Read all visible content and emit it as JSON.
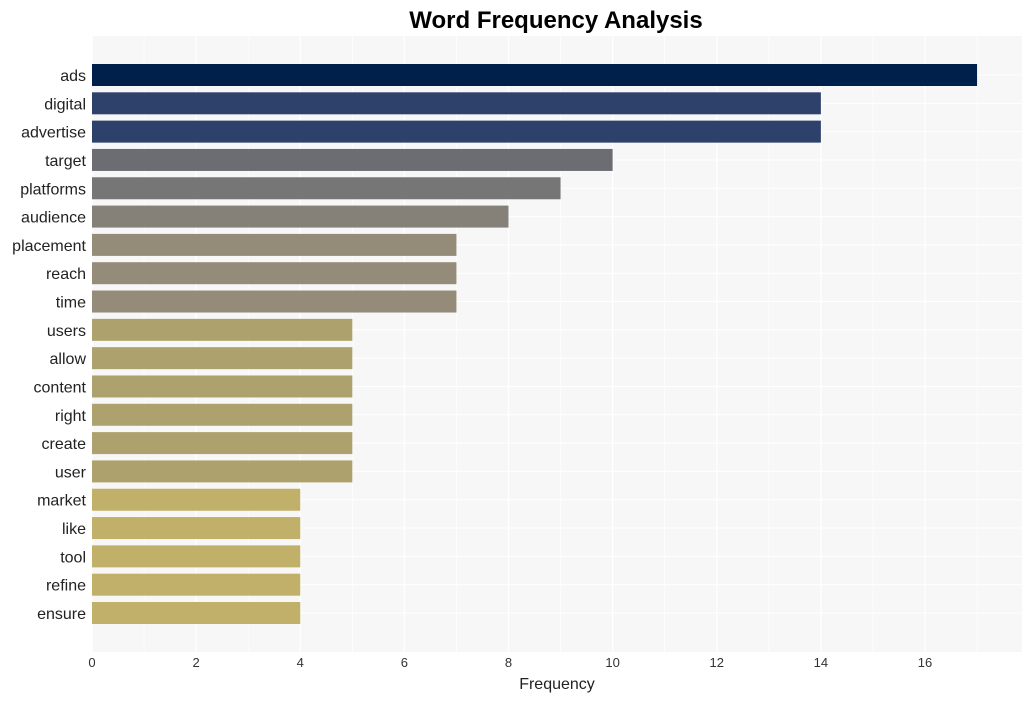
{
  "chart_data": {
    "type": "bar",
    "orientation": "horizontal",
    "title": "Word Frequency Analysis",
    "xlabel": "Frequency",
    "ylabel": "",
    "xlim": [
      0,
      17.8
    ],
    "xticks": [
      0,
      2,
      4,
      6,
      8,
      10,
      12,
      14,
      16
    ],
    "grid": true,
    "legend": "none",
    "categories": [
      "ads",
      "digital",
      "advertise",
      "target",
      "platforms",
      "audience",
      "placement",
      "reach",
      "time",
      "users",
      "allow",
      "content",
      "right",
      "create",
      "user",
      "market",
      "like",
      "tool",
      "refine",
      "ensure"
    ],
    "values": [
      17,
      14,
      14,
      10,
      9,
      8,
      7,
      7,
      7,
      5,
      5,
      5,
      5,
      5,
      5,
      4,
      4,
      4,
      4,
      4
    ],
    "colors": [
      "#00204c",
      "#2e416b",
      "#2e416b",
      "#6c6d72",
      "#777676",
      "#858178",
      "#948c78",
      "#948c78",
      "#948c78",
      "#ada26e",
      "#ada26e",
      "#ada26e",
      "#ada26e",
      "#ada26e",
      "#ada26e",
      "#c1b06a",
      "#c1b06a",
      "#c1b06a",
      "#c1b06a",
      "#c1b06a"
    ],
    "background": "#f7f7f7"
  }
}
